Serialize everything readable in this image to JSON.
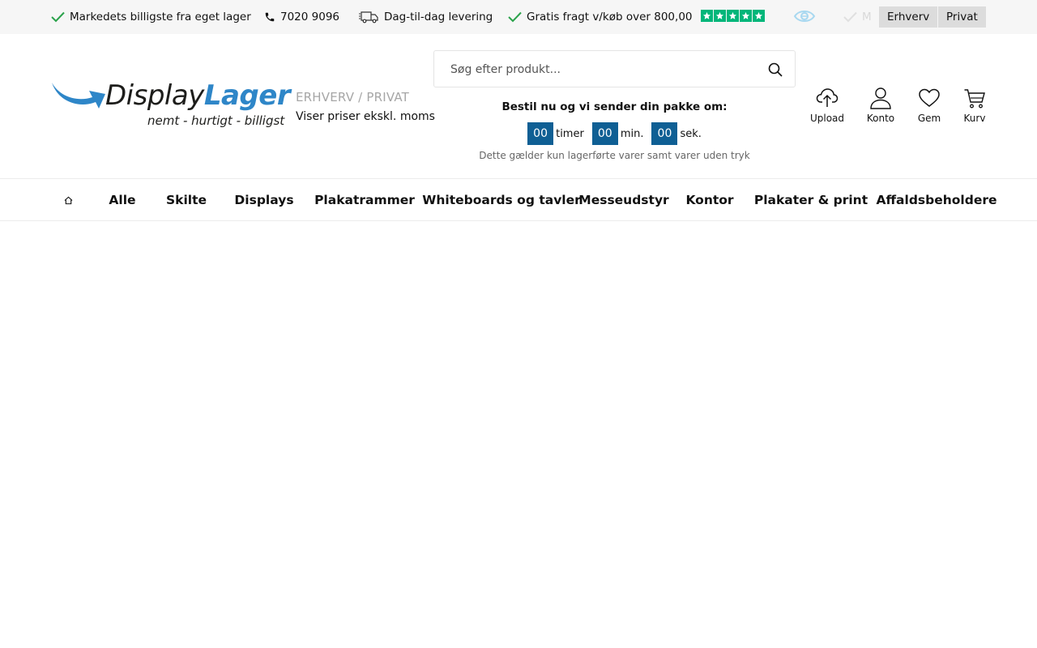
{
  "topbar": {
    "usp_lowest_price": "Markedets billigste fra eget lager",
    "phone": "7020 9096",
    "delivery": "Dag-til-dag levering",
    "free_shipping": "Gratis fragt v/køb over 800,00",
    "faded_usp": "M",
    "btn_business": "Erhverv",
    "btn_private": "Privat"
  },
  "logo": {
    "word_display": "Display",
    "word_lager": "Lager",
    "tagline": "nemt - hurtigt - billigst"
  },
  "price_mode": {
    "label": "ERHVERV / PRIVAT",
    "subtext": "Viser priser ekskl. moms"
  },
  "search": {
    "placeholder": "Søg efter produkt...",
    "value": ""
  },
  "countdown": {
    "title": "Bestil nu og vi sender din pakke om:",
    "hours": "00",
    "hours_unit": "timer",
    "minutes": "00",
    "minutes_unit": "min.",
    "seconds": "00",
    "seconds_unit": "sek.",
    "note": "Dette gælder kun lagerførte varer samt varer uden tryk"
  },
  "header_icons": {
    "upload": "Upload",
    "account": "Konto",
    "save": "Gem",
    "cart": "Kurv"
  },
  "nav": {
    "items": [
      "Alle",
      "Skilte",
      "Displays",
      "Plakatrammer",
      "Whiteboards og tavler",
      "Messeudstyr",
      "Kontor",
      "Plakater & print",
      "Affaldsbeholdere"
    ]
  },
  "colors": {
    "brand_blue": "#2e86c8",
    "countdown_blue": "#0f5f94",
    "check_green": "#2aa24b",
    "trustpilot_green": "#00b67a",
    "topbar_bg": "#f6f6f6"
  },
  "icons": [
    "check-icon",
    "phone-icon",
    "truck-icon",
    "star-icon",
    "eye-icon",
    "search-icon",
    "upload-cloud-icon",
    "user-icon",
    "heart-icon",
    "cart-icon",
    "home-icon",
    "logo-arrow-icon"
  ]
}
